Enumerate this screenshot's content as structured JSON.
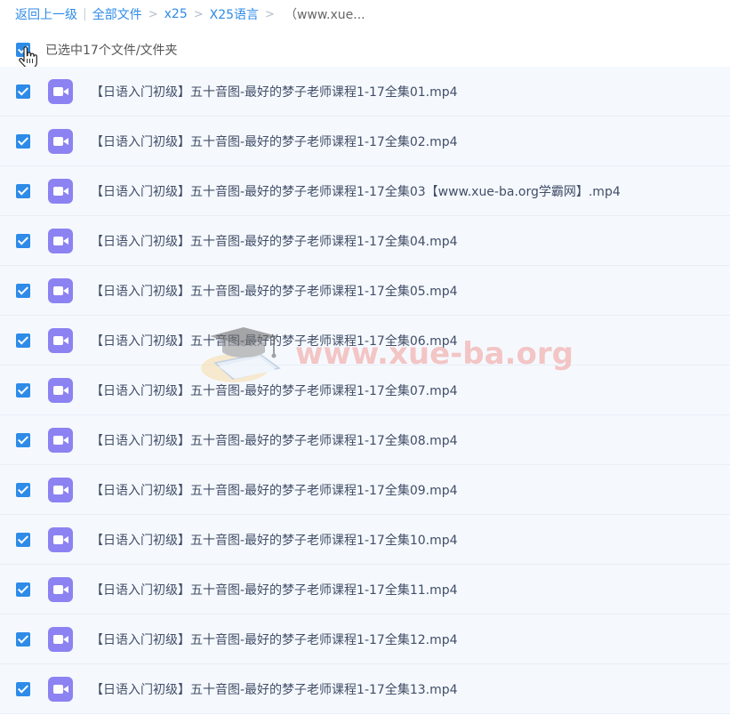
{
  "breadcrumb": {
    "back": "返回上一级",
    "separator_bar": "|",
    "items": [
      "全部文件",
      "x25",
      "X25语言"
    ],
    "separator": ">",
    "current": "（www.xue..."
  },
  "selection": {
    "label": "已选中17个文件/文件夹",
    "checked": true
  },
  "files": [
    {
      "name": "【日语入门初级】五十音图-最好的梦子老师课程1-17全集01.mp4",
      "checked": true,
      "icon": "video-file-icon"
    },
    {
      "name": "【日语入门初级】五十音图-最好的梦子老师课程1-17全集02.mp4",
      "checked": true,
      "icon": "video-file-icon"
    },
    {
      "name": "【日语入门初级】五十音图-最好的梦子老师课程1-17全集03【www.xue-ba.org学霸网】.mp4",
      "checked": true,
      "icon": "video-file-icon"
    },
    {
      "name": "【日语入门初级】五十音图-最好的梦子老师课程1-17全集04.mp4",
      "checked": true,
      "icon": "video-file-icon"
    },
    {
      "name": "【日语入门初级】五十音图-最好的梦子老师课程1-17全集05.mp4",
      "checked": true,
      "icon": "video-file-icon"
    },
    {
      "name": "【日语入门初级】五十音图-最好的梦子老师课程1-17全集06.mp4",
      "checked": true,
      "icon": "video-file-icon"
    },
    {
      "name": "【日语入门初级】五十音图-最好的梦子老师课程1-17全集07.mp4",
      "checked": true,
      "icon": "video-file-icon"
    },
    {
      "name": "【日语入门初级】五十音图-最好的梦子老师课程1-17全集08.mp4",
      "checked": true,
      "icon": "video-file-icon"
    },
    {
      "name": "【日语入门初级】五十音图-最好的梦子老师课程1-17全集09.mp4",
      "checked": true,
      "icon": "video-file-icon"
    },
    {
      "name": "【日语入门初级】五十音图-最好的梦子老师课程1-17全集10.mp4",
      "checked": true,
      "icon": "video-file-icon"
    },
    {
      "name": "【日语入门初级】五十音图-最好的梦子老师课程1-17全集11.mp4",
      "checked": true,
      "icon": "video-file-icon"
    },
    {
      "name": "【日语入门初级】五十音图-最好的梦子老师课程1-17全集12.mp4",
      "checked": true,
      "icon": "video-file-icon"
    },
    {
      "name": "【日语入门初级】五十音图-最好的梦子老师课程1-17全集13.mp4",
      "checked": true,
      "icon": "video-file-icon"
    }
  ],
  "watermark": {
    "text": "www.xue-ba.org"
  },
  "colors": {
    "accent": "#2e8be8",
    "row_background": "#f5f9fe",
    "video_icon": "#8c82f2",
    "file_name_text": "#424e67"
  }
}
